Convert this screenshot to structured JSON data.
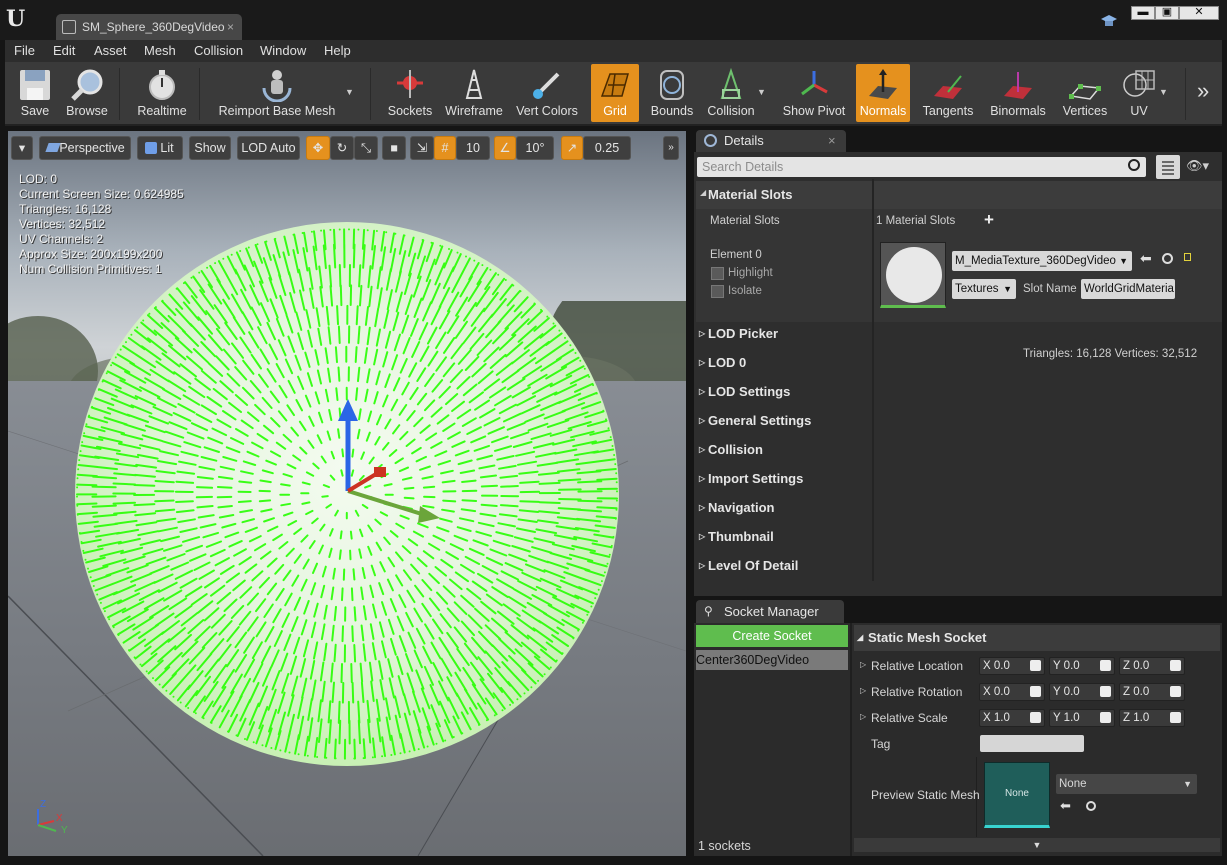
{
  "window": {
    "tab_title": "SM_Sphere_360DegVideo",
    "tab_close": "×",
    "controls": [
      "▬",
      "▣",
      "✕"
    ]
  },
  "menu": [
    "File",
    "Edit",
    "Asset",
    "Mesh",
    "Collision",
    "Window",
    "Help"
  ],
  "toolbar": {
    "items": [
      {
        "label": "Save",
        "icon": "save-icon"
      },
      {
        "label": "Browse",
        "icon": "browse-icon"
      },
      {
        "label": "Realtime",
        "icon": "stopwatch-icon"
      },
      {
        "label": "Reimport Base Mesh",
        "icon": "reimport-icon"
      },
      {
        "label": "Sockets",
        "icon": "sockets-icon"
      },
      {
        "label": "Wireframe",
        "icon": "wireframe-icon"
      },
      {
        "label": "Vert Colors",
        "icon": "vert-colors-icon"
      },
      {
        "label": "Grid",
        "icon": "grid-icon",
        "active": true
      },
      {
        "label": "Bounds",
        "icon": "bounds-icon"
      },
      {
        "label": "Collision",
        "icon": "collision-icon"
      },
      {
        "label": "Show Pivot",
        "icon": "pivot-icon"
      },
      {
        "label": "Normals",
        "icon": "normals-icon",
        "active": true
      },
      {
        "label": "Tangents",
        "icon": "tangents-icon"
      },
      {
        "label": "Binormals",
        "icon": "binormals-icon"
      },
      {
        "label": "Vertices",
        "icon": "vertices-icon"
      },
      {
        "label": "UV",
        "icon": "uv-icon"
      }
    ],
    "overflow": "»",
    "accent": "#e5911e"
  },
  "viewport": {
    "perspective": "Perspective",
    "lit": "Lit",
    "show": "Show",
    "lod": "LOD Auto",
    "grid_snap": "10",
    "rot_snap": "10°",
    "scale_snap": "0.25",
    "stats": [
      "LOD:  0",
      "Current Screen Size:  0.624985",
      "Triangles:  16,128",
      "Vertices:  32,512",
      "UV Channels:  2",
      "Approx Size: 200x199x200",
      "Num Collision Primitives:  1"
    ],
    "axis": {
      "z": "Z",
      "x": "X",
      "y": "Y"
    },
    "normals_color": "#26ff00"
  },
  "details": {
    "tab": "Details",
    "close": "×",
    "search_placeholder": "Search Details",
    "material_slots_header": "Material Slots",
    "material_slots_label": "Material Slots",
    "slots_count": "1 Material Slots",
    "add": "+",
    "element_label": "Element 0",
    "highlight": "Highlight",
    "isolate": "Isolate",
    "material_name": "M_MediaTexture_360DegVideo",
    "textures": "Textures",
    "slot_name_label": "Slot Name",
    "slot_name_value": "WorldGridMateria",
    "lod_summary": "Triangles: 16,128   Vertices: 32,512",
    "categories": [
      "LOD Picker",
      "LOD 0",
      "LOD Settings",
      "General Settings",
      "Collision",
      "Import Settings",
      "Navigation",
      "Thumbnail",
      "Level Of Detail"
    ]
  },
  "socket_manager": {
    "tab": "Socket Manager",
    "create_button": "Create Socket",
    "socket_name": "Center360DegVideo",
    "section": "Static Mesh Socket",
    "relative_location": {
      "label": "Relative Location",
      "x": "0.0",
      "y": "0.0",
      "z": "0.0"
    },
    "relative_rotation": {
      "label": "Relative Rotation",
      "x": "0.0",
      "y": "0.0",
      "z": "0.0"
    },
    "relative_scale": {
      "label": "Relative Scale",
      "x": "1.0",
      "y": "1.0",
      "z": "1.0"
    },
    "tag_label": "Tag",
    "preview_label": "Preview Static Mesh",
    "preview_thumb": "None",
    "preview_value": "None",
    "count": "1 sockets"
  }
}
